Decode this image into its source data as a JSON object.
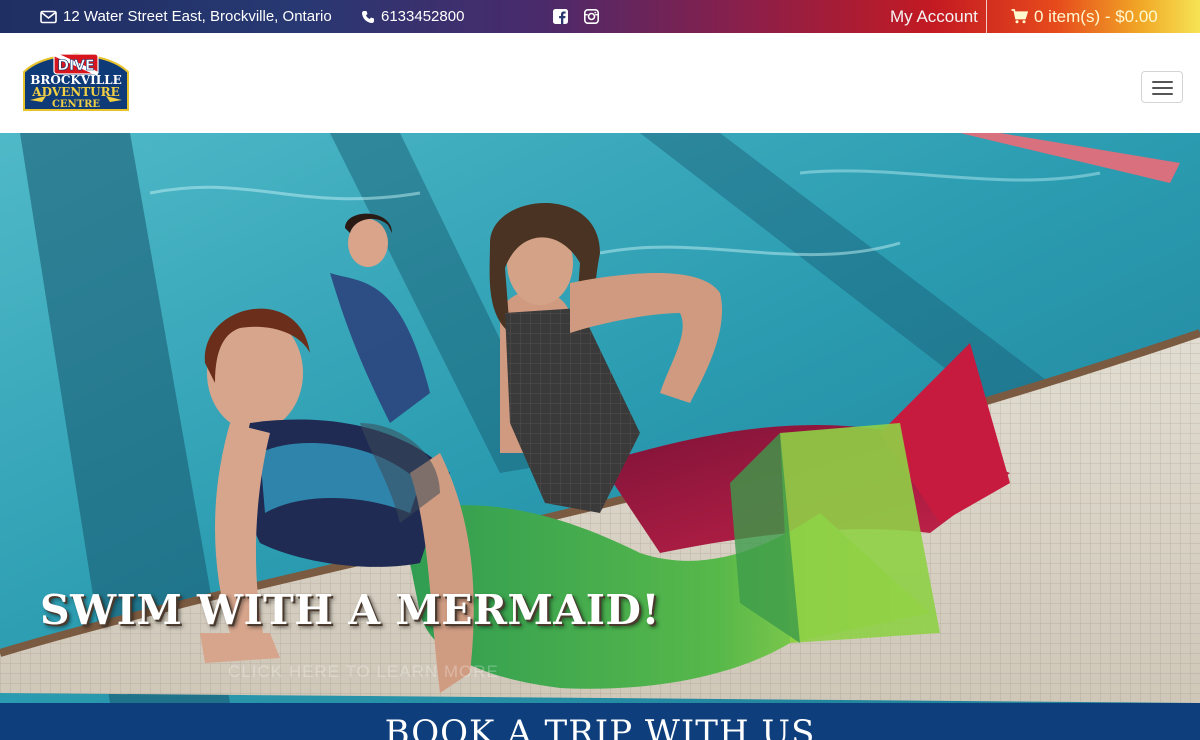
{
  "topbar": {
    "address": "12 Water Street East, Brockville, Ontario",
    "phone": "6133452800",
    "my_account": "My Account",
    "cart": "0 item(s) - $0.00"
  },
  "logo": {
    "top": "DIVE",
    "line1": "BROCKVILLE",
    "line2": "ADVENTURE",
    "line3": "CENTRE"
  },
  "hero": {
    "title": "SWIM WITH A MERMAID!",
    "subtitle": "CLICK HERE TO LEARN MORE"
  },
  "band": {
    "title": "BOOK A TRIP WITH US"
  },
  "colors": {
    "band_blue": "#0e3f7c",
    "pool": "#2fa3b3",
    "tail_green": "#59b54a",
    "tail_red": "#b8143c"
  }
}
